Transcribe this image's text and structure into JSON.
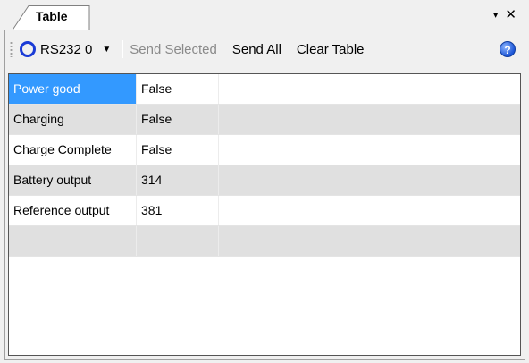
{
  "tab": {
    "title": "Table"
  },
  "window": {
    "pin_glyph": "▾",
    "close_glyph": "✕"
  },
  "toolbar": {
    "port_label": "RS232 0",
    "send_selected": "Send Selected",
    "send_all": "Send All",
    "clear_table": "Clear Table",
    "help_glyph": "?"
  },
  "colors": {
    "selection": "#3399ff",
    "port_ring": "#1a3bd6",
    "disabled_text": "#8a8a8a",
    "alt_row": "#e0e0e0"
  },
  "table": {
    "rows": [
      {
        "name": "Power good",
        "value": "False",
        "extra": ""
      },
      {
        "name": "Charging",
        "value": "False",
        "extra": ""
      },
      {
        "name": "Charge Complete",
        "value": "False",
        "extra": ""
      },
      {
        "name": "Battery output",
        "value": "314",
        "extra": ""
      },
      {
        "name": "Reference output",
        "value": "381",
        "extra": ""
      },
      {
        "name": "",
        "value": "",
        "extra": ""
      }
    ]
  }
}
